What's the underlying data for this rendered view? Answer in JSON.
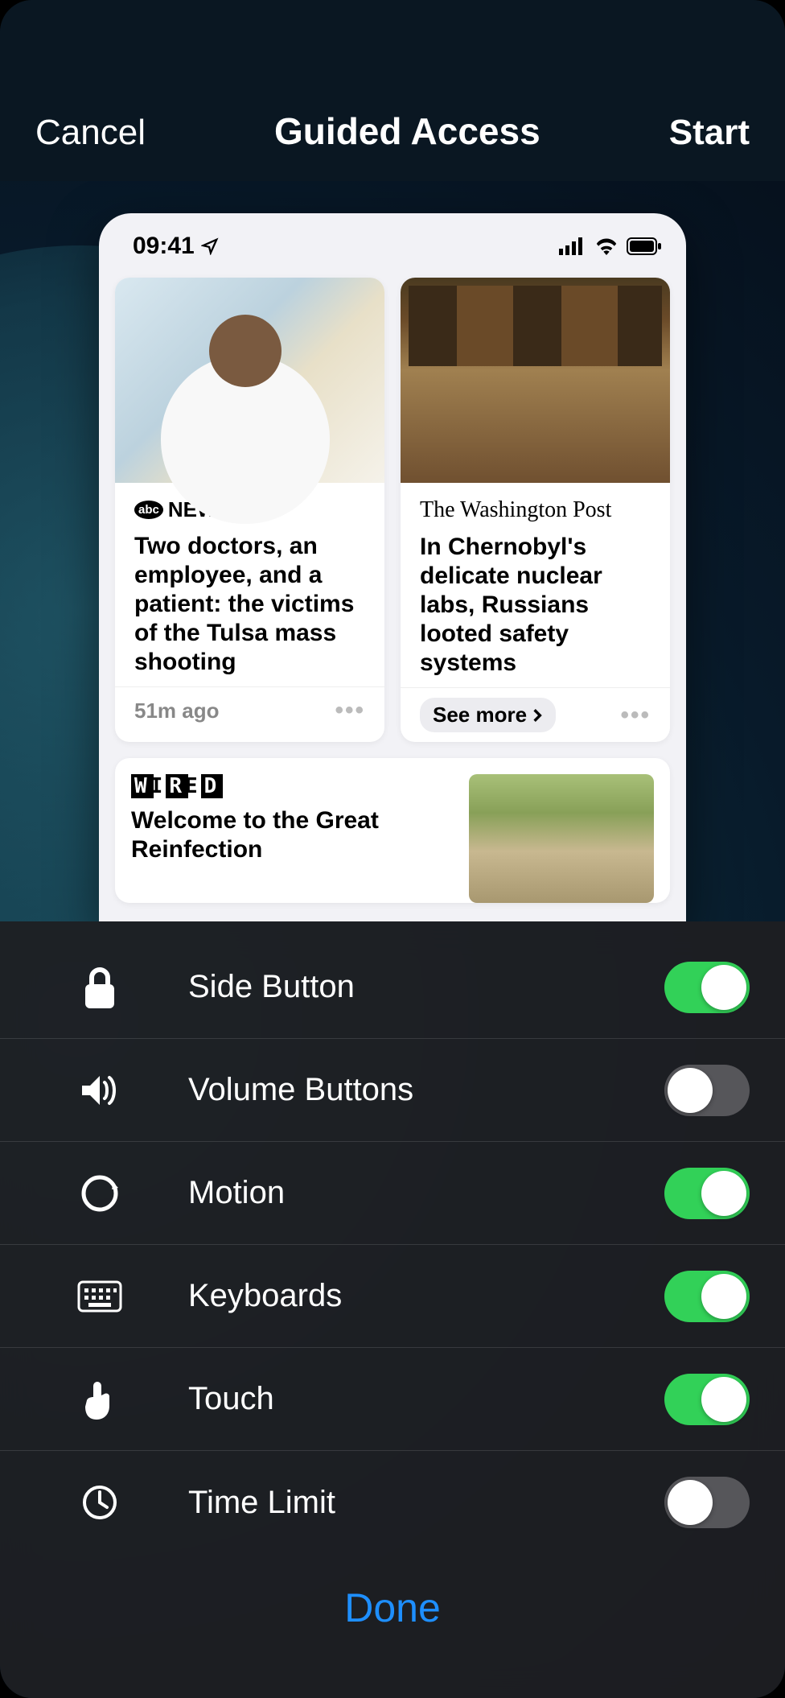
{
  "nav": {
    "cancel": "Cancel",
    "title": "Guided Access",
    "start": "Start"
  },
  "preview": {
    "status_time": "09:41",
    "cards": [
      {
        "source": "NEWS",
        "source_prefix": "abc",
        "headline": "Two doctors, an employee, and a patient: the victims of the Tulsa mass shooting",
        "footer_left": "51m ago"
      },
      {
        "source": "The Washington Post",
        "headline": "In Chernobyl's delicate nuclear labs, Russians looted safety systems",
        "footer_left": "See more"
      }
    ],
    "wide_card": {
      "source": "WIRED",
      "headline": "Welcome to the Great Reinfection"
    }
  },
  "options": [
    {
      "icon": "lock-icon",
      "label": "Side Button",
      "on": true
    },
    {
      "icon": "volume-icon",
      "label": "Volume Buttons",
      "on": false
    },
    {
      "icon": "motion-icon",
      "label": "Motion",
      "on": true
    },
    {
      "icon": "keyboard-icon",
      "label": "Keyboards",
      "on": true
    },
    {
      "icon": "touch-icon",
      "label": "Touch",
      "on": true
    },
    {
      "icon": "timer-icon",
      "label": "Time Limit",
      "on": false
    }
  ],
  "done": "Done"
}
